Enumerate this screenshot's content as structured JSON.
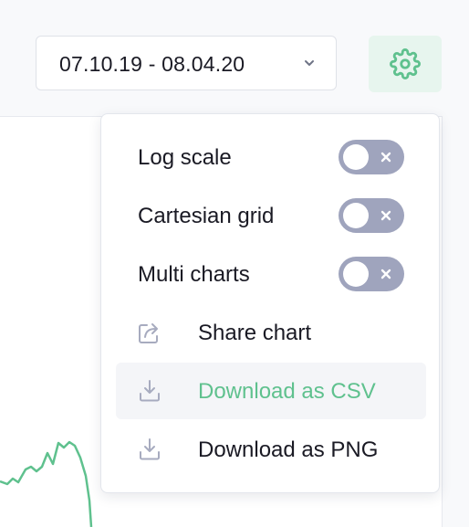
{
  "header": {
    "date_range": "07.10.19 - 08.04.20",
    "chevron_icon": "chevron-down-icon",
    "settings_icon": "gear-icon"
  },
  "colors": {
    "accent_green": "#5fc18e",
    "toggle_off": "#9fa4bd",
    "icon_gray": "#a7abbf",
    "text": "#1a1a24"
  },
  "settings_menu": {
    "toggles": [
      {
        "label": "Log scale",
        "enabled": false
      },
      {
        "label": "Cartesian grid",
        "enabled": false
      },
      {
        "label": "Multi charts",
        "enabled": false
      }
    ],
    "actions": [
      {
        "label": "Share chart",
        "icon": "share-icon",
        "active": false
      },
      {
        "label": "Download as CSV",
        "icon": "download-icon",
        "active": true
      },
      {
        "label": "Download as PNG",
        "icon": "download-icon",
        "active": false
      }
    ]
  }
}
